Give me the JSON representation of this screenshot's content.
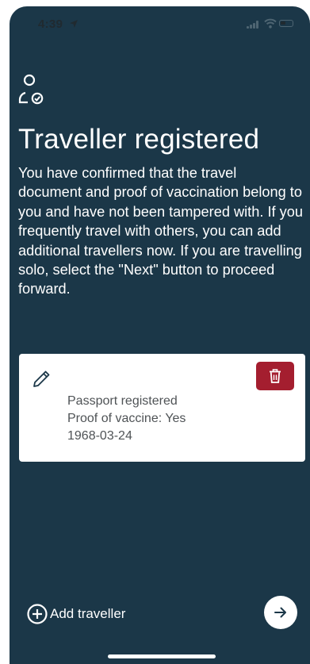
{
  "status_bar": {
    "time": "4:39",
    "icons": [
      "location-arrow-icon",
      "cellular-signal-icon",
      "wifi-icon",
      "battery-icon"
    ]
  },
  "header": {
    "icon": "user-check-icon",
    "title": "Traveller registered",
    "description": "You have confirmed that the travel document and proof of vaccination belong to you and have not been tampered with. If you frequently travel with others, you can add additional travellers now. If you are travelling solo, select the \"Next\" button to proceed forward."
  },
  "traveller_card": {
    "edit_icon": "pencil-icon",
    "delete_icon": "trash-icon",
    "lines": [
      "Passport registered",
      "Proof of vaccine: Yes",
      "1968-03-24"
    ]
  },
  "footer": {
    "add_traveller_label": "Add traveller",
    "add_icon": "plus-circle-icon",
    "next_icon": "arrow-right-icon"
  },
  "colors": {
    "background": "#1b3748",
    "card": "#ffffff",
    "delete_button": "#a41e2f",
    "card_text": "#4f5356",
    "edit_icon": "#1b3748"
  }
}
